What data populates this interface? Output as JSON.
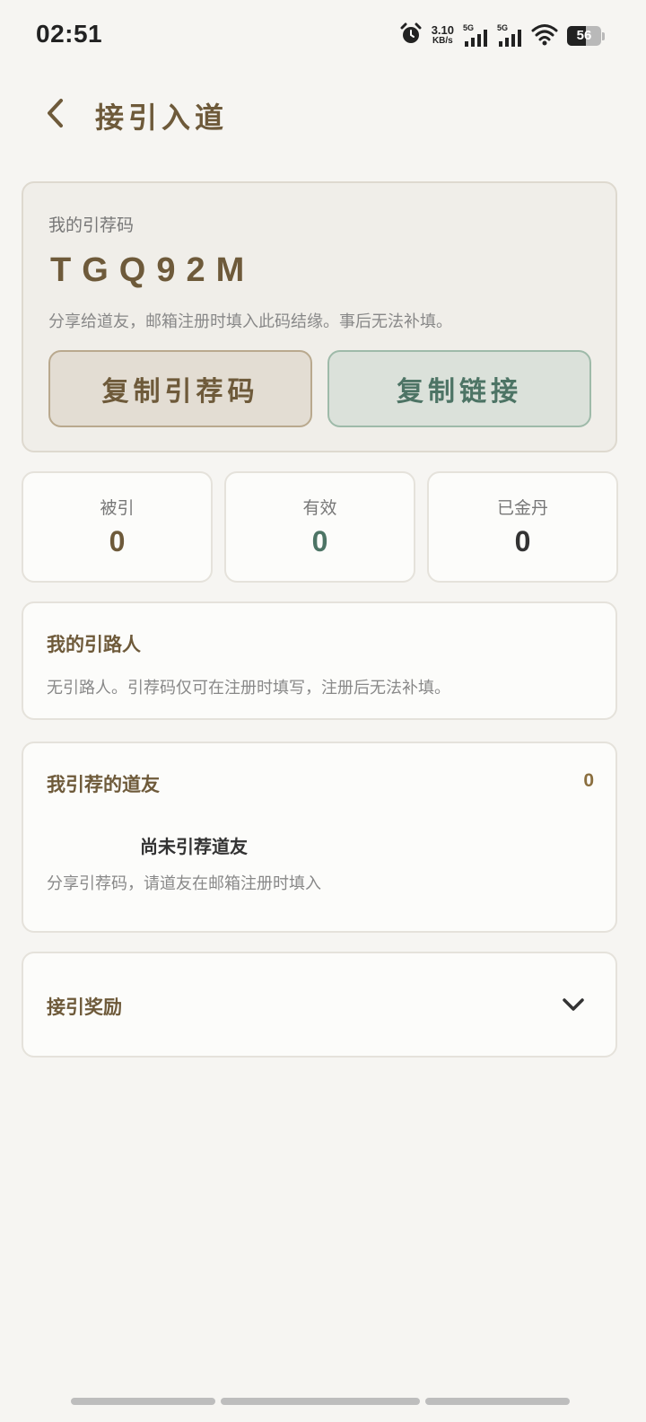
{
  "status_bar": {
    "time": "02:51",
    "net_speed_value": "3.10",
    "net_speed_unit": "KB/s",
    "signal1_label": "5G",
    "signal2_label": "5G",
    "battery_level": "56",
    "icons": [
      "alarm-icon",
      "signal-icon",
      "signal-icon",
      "wifi-icon",
      "battery-icon"
    ]
  },
  "header": {
    "title": "接引入道",
    "back_icon": "chevron-left-icon"
  },
  "referral": {
    "label": "我的引荐码",
    "code": "TGQ92M",
    "description": "分享给道友，邮箱注册时填入此码结缘。事后无法补填。",
    "copy_code_label": "复制引荐码",
    "copy_link_label": "复制链接"
  },
  "stats": [
    {
      "label": "被引",
      "value": "0",
      "color": "#6e5a3a"
    },
    {
      "label": "有效",
      "value": "0",
      "color": "#4d7465"
    },
    {
      "label": "已金丹",
      "value": "0",
      "color": "#333333"
    }
  ],
  "mentor": {
    "title": "我的引路人",
    "text": "无引路人。引荐码仅可在注册时填写，注册后无法补填。"
  },
  "friends": {
    "title": "我引荐的道友",
    "count": "0",
    "empty_title": "尚未引荐道友",
    "empty_text": "分享引荐码，请道友在邮箱注册时填入"
  },
  "rewards": {
    "title": "接引奖励",
    "toggle_icon": "chevron-down-icon"
  },
  "colors": {
    "accent_brown": "#6e5a3a",
    "accent_green": "#4d7465",
    "background": "#f6f5f2"
  }
}
